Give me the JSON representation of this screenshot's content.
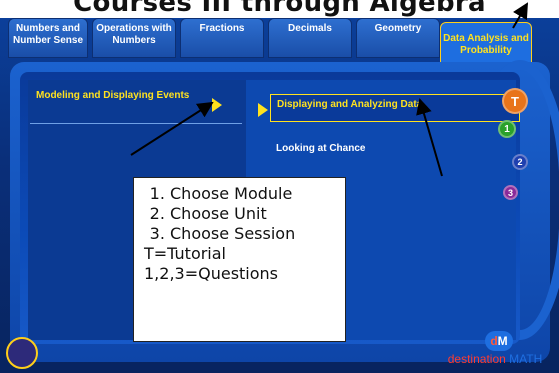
{
  "banner": "Courses III through Algebra",
  "tabs": [
    {
      "label": "Numbers and Number Sense"
    },
    {
      "label": "Operations with Numbers"
    },
    {
      "label": "Fractions"
    },
    {
      "label": "Decimals"
    },
    {
      "label": "Geometry"
    },
    {
      "label": "Data Analysis and Probability"
    }
  ],
  "module": {
    "label": "Modeling and Displaying Events"
  },
  "unit": {
    "label": "Displaying and Analyzing Data"
  },
  "session": {
    "label": "Looking at Chance"
  },
  "badges": [
    {
      "label": "T",
      "color": "#e8741a"
    },
    {
      "label": "1",
      "color": "#2aa12a"
    },
    {
      "label": "2",
      "color": "#1e3fb0"
    },
    {
      "label": "3",
      "color": "#8a2a9a"
    }
  ],
  "callout": {
    "items": [
      "Choose Module",
      "Choose Unit",
      "Choose Session"
    ],
    "line1": "T=Tutorial",
    "line2": "1,2,3=Questions"
  },
  "logo": {
    "mark_d": "d",
    "mark_m": "M",
    "word_a": "destination",
    "word_b": "MATH"
  }
}
